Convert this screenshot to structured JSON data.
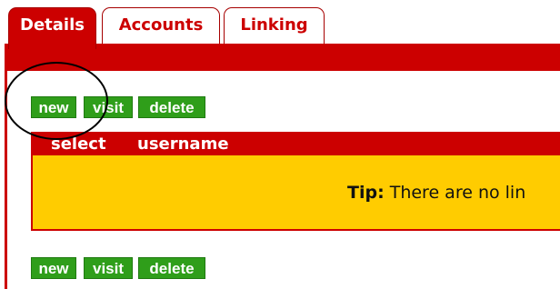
{
  "tabs": [
    {
      "label": "Details",
      "active": true
    },
    {
      "label": "Accounts",
      "active": false
    },
    {
      "label": "Linking",
      "active": false
    }
  ],
  "toolbar_top": {
    "new_label": "new",
    "visit_label": "visit",
    "delete_label": "delete"
  },
  "toolbar_bottom": {
    "new_label": "new",
    "visit_label": "visit",
    "delete_label": "delete"
  },
  "table": {
    "columns": [
      "select",
      "username"
    ]
  },
  "tip": {
    "label": "Tip:",
    "text": " There are no lin"
  },
  "colors": {
    "accent_red": "#cc0000",
    "button_green": "#2f9e1a",
    "tip_yellow": "#ffcc00"
  }
}
